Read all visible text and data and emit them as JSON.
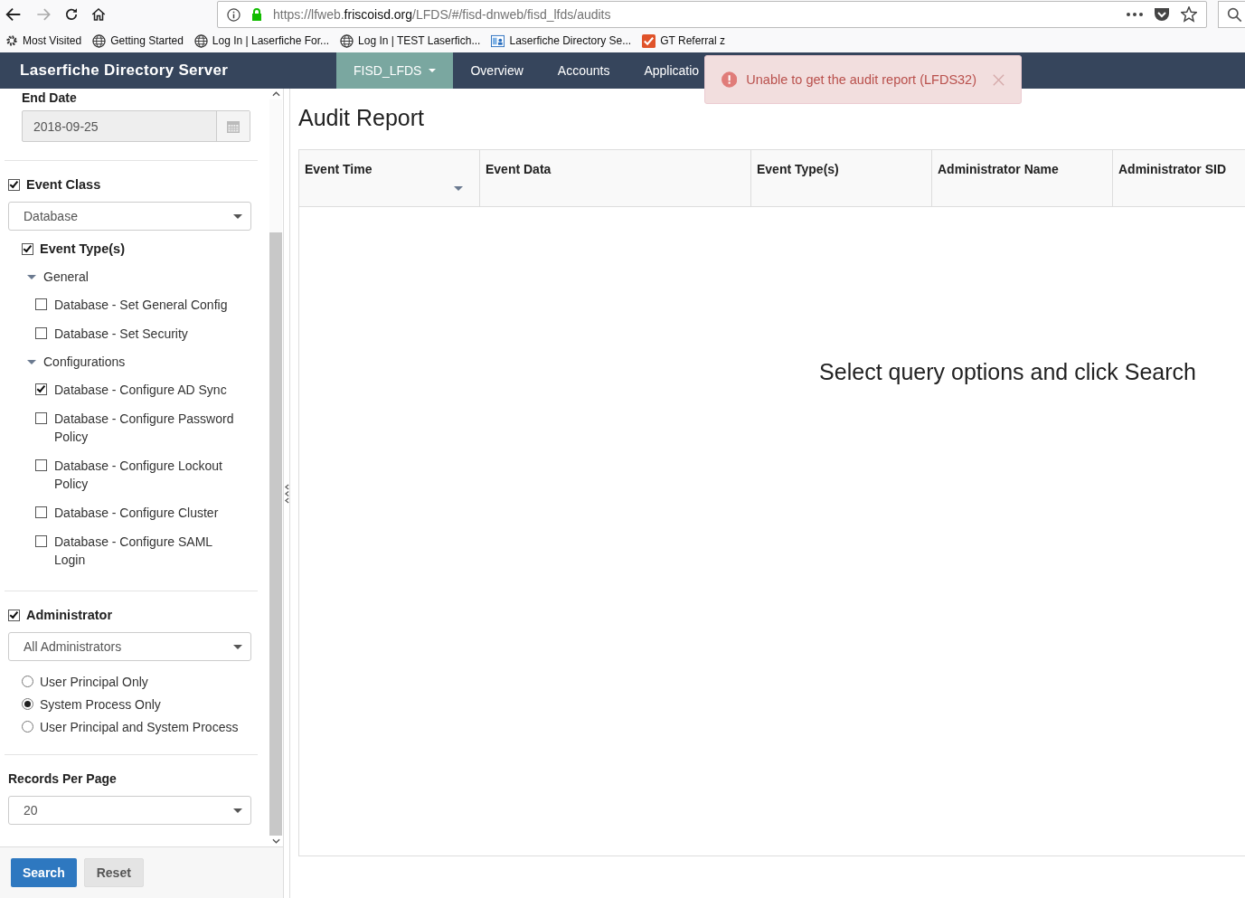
{
  "browser": {
    "url": {
      "scheme": "https://lfweb.",
      "domain": "friscoisd.org",
      "path": "/LFDS/#/fisd-dnweb/fisd_lfds/audits"
    },
    "bookmarks": [
      {
        "label": "Most Visited",
        "kind": "gear"
      },
      {
        "label": "Getting Started",
        "kind": "globe"
      },
      {
        "label": "Log In | Laserfiche For...",
        "kind": "globe"
      },
      {
        "label": "Log In | TEST Laserfich...",
        "kind": "globe"
      },
      {
        "label": "Laserfiche Directory Se...",
        "kind": "app"
      },
      {
        "label": "GT Referral z",
        "kind": "check"
      }
    ]
  },
  "navbar": {
    "brand": "Laserfiche Directory Server",
    "tabs": [
      {
        "label": "FISD_LFDS",
        "selected": true,
        "dropdown": true
      },
      {
        "label": "Overview",
        "selected": false,
        "dropdown": false
      },
      {
        "label": "Accounts",
        "selected": false,
        "dropdown": false
      },
      {
        "label": "Applicatio",
        "selected": false,
        "dropdown": false
      }
    ]
  },
  "alert": {
    "message": "Unable to get the audit report (LFDS32)"
  },
  "sidebar": {
    "end_date": {
      "label": "End Date",
      "value": "2018-09-25"
    },
    "event_class": {
      "label": "Event Class",
      "checked": true,
      "value": "Database"
    },
    "event_types": {
      "label": "Event Type(s)",
      "checked": true,
      "groups": [
        {
          "label": "General",
          "expanded": true,
          "children": [
            {
              "label": "Database - Set General Config",
              "checked": false
            },
            {
              "label": "Database - Set Security",
              "checked": false
            }
          ]
        },
        {
          "label": "Configurations",
          "expanded": true,
          "children": [
            {
              "label": "Database - Configure AD Sync",
              "checked": true
            },
            {
              "label": "Database - Configure Password Policy",
              "checked": false
            },
            {
              "label": "Database - Configure Lockout Policy",
              "checked": false
            },
            {
              "label": "Database - Configure Cluster",
              "checked": false
            },
            {
              "label": "Database - Configure SAML Login",
              "checked": false
            }
          ]
        }
      ]
    },
    "administrator": {
      "label": "Administrator",
      "checked": true,
      "value": "All Administrators",
      "options": [
        {
          "label": "User Principal Only",
          "selected": false
        },
        {
          "label": "System Process Only",
          "selected": true
        },
        {
          "label": "User Principal and System Process",
          "selected": false
        }
      ]
    },
    "records_per_page": {
      "label": "Records Per Page",
      "value": "20"
    },
    "buttons": [
      {
        "label": "Search",
        "kind": "primary"
      },
      {
        "label": "Reset",
        "kind": "default"
      }
    ]
  },
  "main": {
    "title": "Audit Report",
    "columns": [
      {
        "label": "Event Time",
        "sorted": true
      },
      {
        "label": "Event Data",
        "sorted": false
      },
      {
        "label": "Event Type(s)",
        "sorted": false
      },
      {
        "label": "Administrator Name",
        "sorted": false
      },
      {
        "label": "Administrator SID",
        "sorted": false
      }
    ],
    "empty_message": "Select query options and click Search"
  }
}
